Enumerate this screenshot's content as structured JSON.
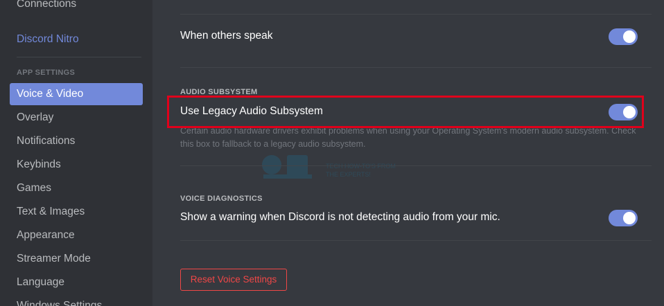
{
  "sidebar": {
    "connections": "Connections",
    "nitro": "Discord Nitro",
    "app_settings_header": "APP SETTINGS",
    "items": [
      {
        "label": "Voice & Video"
      },
      {
        "label": "Overlay"
      },
      {
        "label": "Notifications"
      },
      {
        "label": "Keybinds"
      },
      {
        "label": "Games"
      },
      {
        "label": "Text & Images"
      },
      {
        "label": "Appearance"
      },
      {
        "label": "Streamer Mode"
      },
      {
        "label": "Language"
      },
      {
        "label": "Windows Settings"
      }
    ]
  },
  "main": {
    "others_speak_label": "When others speak",
    "audio_subsystem": {
      "header": "AUDIO SUBSYSTEM",
      "label": "Use Legacy Audio Subsystem",
      "note": "Certain audio hardware drivers exhibit problems when using your Operating System's modern audio subsystem. Check this box to fallback to a legacy audio subsystem."
    },
    "voice_diagnostics": {
      "header": "VOICE DIAGNOSTICS",
      "label": "Show a warning when Discord is not detecting audio from your mic."
    },
    "reset_button": "Reset Voice Settings",
    "watermark_lines": [
      "TECH HOW-TO'S FROM",
      "THE EXPERTS!"
    ]
  },
  "colors": {
    "accent": "#7289da",
    "danger": "#f04747",
    "highlight": "#e0001b"
  },
  "toggles": {
    "others_speak": true,
    "legacy_audio": true,
    "voice_diagnostics": true
  }
}
